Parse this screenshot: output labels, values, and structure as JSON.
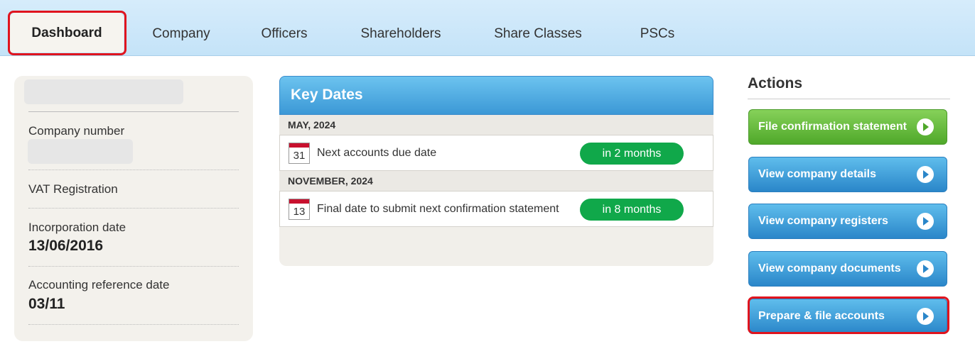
{
  "nav": {
    "tabs": [
      "Dashboard",
      "Company",
      "Officers",
      "Shareholders",
      "Share Classes",
      "PSCs"
    ],
    "active": "Dashboard"
  },
  "company_panel": {
    "company_number_label": "Company number",
    "vat_label": "VAT Registration",
    "incorporation_label": "Incorporation date",
    "incorporation_value": "13/06/2016",
    "accounting_ref_label": "Accounting reference date",
    "accounting_ref_value": "03/11"
  },
  "key_dates": {
    "title": "Key Dates",
    "groups": [
      {
        "month": "MAY, 2024",
        "day": "31",
        "text": "Next accounts due date",
        "badge": "in 2 months"
      },
      {
        "month": "NOVEMBER, 2024",
        "day": "13",
        "text": "Final date to submit next confirmation statement",
        "badge": "in 8 months"
      }
    ]
  },
  "actions": {
    "title": "Actions",
    "buttons": [
      "File confirmation statement",
      "View company details",
      "View company registers",
      "View company documents",
      "Prepare & file accounts"
    ]
  },
  "colors": {
    "highlight": "#e0141e",
    "badge_green": "#10a84a",
    "button_blue": "#2a86c9",
    "button_green": "#4fa82a"
  }
}
